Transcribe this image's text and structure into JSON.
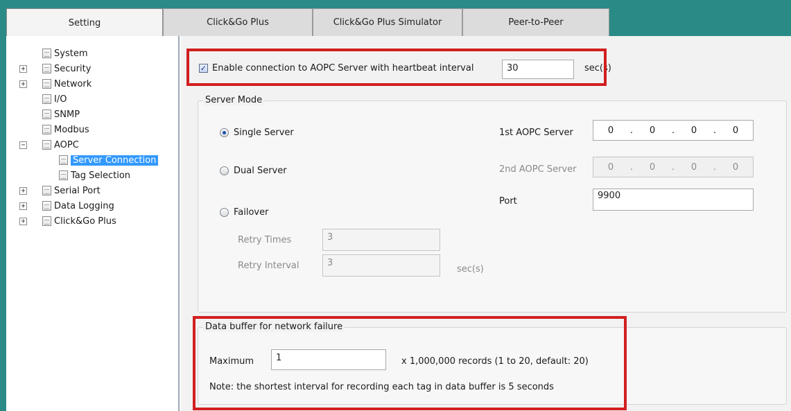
{
  "tabs": [
    {
      "label": "Setting",
      "active": true
    },
    {
      "label": "Click&Go Plus",
      "active": false
    },
    {
      "label": "Click&Go Plus Simulator",
      "active": false
    },
    {
      "label": "Peer-to-Peer",
      "active": false
    }
  ],
  "tree": {
    "items": [
      {
        "label": "System",
        "expander": ""
      },
      {
        "label": "Security",
        "expander": "+"
      },
      {
        "label": "Network",
        "expander": "+"
      },
      {
        "label": "I/O",
        "expander": ""
      },
      {
        "label": "SNMP",
        "expander": ""
      },
      {
        "label": "Modbus",
        "expander": ""
      },
      {
        "label": "AOPC",
        "expander": "−"
      },
      {
        "label": "Server Connection",
        "expander": "",
        "selected": true
      },
      {
        "label": "Tag Selection",
        "expander": ""
      },
      {
        "label": "Serial Port",
        "expander": "+"
      },
      {
        "label": "Data Logging",
        "expander": "+"
      },
      {
        "label": "Click&Go Plus",
        "expander": "+"
      }
    ]
  },
  "heartbeat": {
    "checked": true,
    "label": "Enable connection to AOPC Server with heartbeat interval",
    "value": "30",
    "unit": "sec(s)"
  },
  "server_mode": {
    "title": "Server Mode",
    "options": {
      "single": "Single Server",
      "dual": "Dual Server",
      "failover": "Failover"
    },
    "selected": "single",
    "retry_times_label": "Retry Times",
    "retry_times_value": "3",
    "retry_interval_label": "Retry Interval",
    "retry_interval_value": "3",
    "retry_interval_unit": "sec(s)",
    "first_server_label": "1st AOPC Server",
    "first_server_ip": [
      "0",
      "0",
      "0",
      "0"
    ],
    "second_server_label": "2nd AOPC Server",
    "second_server_ip": [
      "0",
      "0",
      "0",
      "0"
    ],
    "port_label": "Port",
    "port_value": "9900"
  },
  "buffer": {
    "title": "Data buffer for network failure",
    "max_label": "Maximum",
    "max_value": "1",
    "max_hint": "x 1,000,000 records (1 to 20, default: 20)",
    "note": "Note: the shortest interval for recording each tag in data buffer is 5 seconds"
  },
  "colors": {
    "accent_teal": "#2a8a86",
    "highlight_red": "#d21f1f",
    "selection_blue": "#3399ff"
  }
}
